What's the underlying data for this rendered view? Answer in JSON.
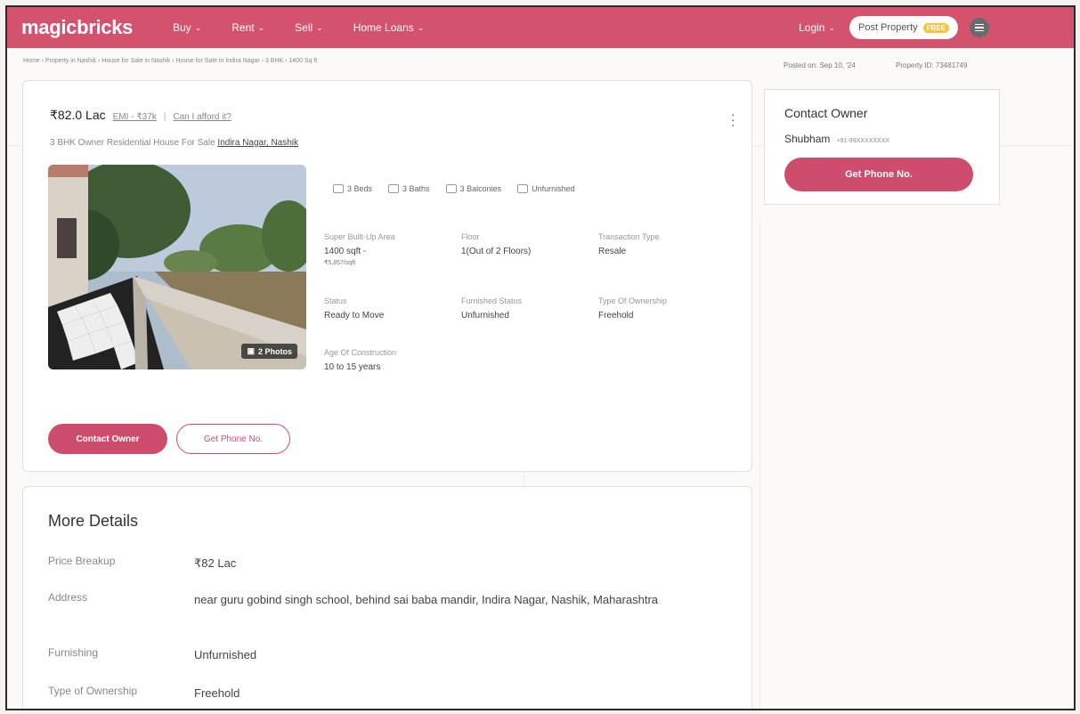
{
  "header": {
    "logo": "magicbricks",
    "nav": [
      {
        "label": "Buy"
      },
      {
        "label": "Rent"
      },
      {
        "label": "Sell"
      },
      {
        "label": "Home Loans"
      }
    ],
    "login": "Login",
    "post_property": "Post Property",
    "free_badge": "FREE"
  },
  "breadcrumb": "Home › Property in Nashik › House for Sale in Nashik › House for Sale in Indira Nagar › 3 BHK › 1400 Sq ft",
  "meta": {
    "posted": "Posted on: Sep 10, '24",
    "property_id": "Property ID: 73481749"
  },
  "listing": {
    "price": "₹82.0 Lac",
    "emi": "EMI - ₹37k",
    "separator": "|",
    "afford": "Can I afford it?",
    "subtitle": "3 BHK Owner Residential House For Sale",
    "locality": "Indira Nagar, Nashik",
    "photos_badge": "2 Photos",
    "amenities": [
      {
        "label": "3 Beds",
        "icon": "bed-icon"
      },
      {
        "label": "3 Baths",
        "icon": "bath-icon"
      },
      {
        "label": "3 Balconies",
        "icon": "balcony-icon"
      },
      {
        "label": "Unfurnished",
        "icon": "furnishing-icon"
      }
    ],
    "specs": {
      "area_label": "Super Built-Up Area",
      "area_value": "1400 sqft -",
      "area_rate": "₹5,857/sqft",
      "floor_label": "Floor",
      "floor_value": "1(Out of 2 Floors)",
      "transaction_label": "Transaction Type",
      "transaction_value": "Resale",
      "status_label": "Status",
      "status_value": "Ready to Move",
      "furnished_label": "Furnished Status",
      "furnished_value": "Unfurnished",
      "ownership_label": "Type Of Ownership",
      "ownership_value": "Freehold",
      "age_label": "Age Of Construction",
      "age_value": "10 to 15 years"
    },
    "contact_owner_btn": "Contact Owner",
    "get_phone_btn": "Get Phone No."
  },
  "contact": {
    "title": "Contact Owner",
    "owner_name": "Shubham",
    "owner_phone": "+91-99XXXXXXXX",
    "get_phone_btn": "Get Phone No."
  },
  "more_details": {
    "title": "More Details",
    "rows": [
      {
        "label": "Price Breakup",
        "value": "₹82 Lac"
      },
      {
        "label": "Address",
        "value": "near guru gobind singh school, behind sai baba mandir, Indira Nagar, Nashik, Maharashtra"
      },
      {
        "label": "Furnishing",
        "value": "Unfurnished"
      },
      {
        "label": "Type of Ownership",
        "value": "Freehold"
      }
    ]
  },
  "colors": {
    "brand": "#d3536f",
    "button": "#cf4d6c"
  }
}
